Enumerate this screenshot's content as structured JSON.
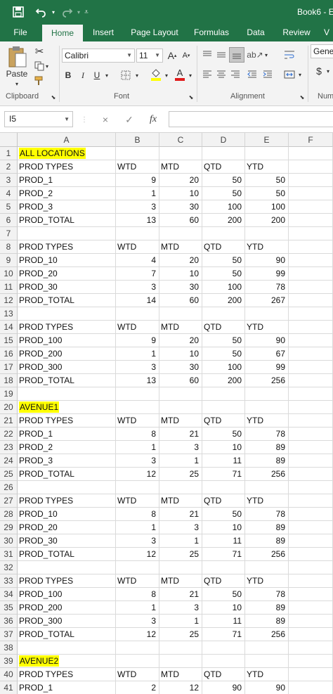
{
  "app": {
    "title": "Book6 - E",
    "accent": "#217346",
    "highlight": "#ffff00"
  },
  "quick_access": {
    "save_icon": "save-icon",
    "undo_icon": "undo-icon",
    "redo_icon": "redo-icon",
    "customize_icon": "customize-qat-icon"
  },
  "tabs": [
    {
      "label": "File",
      "active": false
    },
    {
      "label": "Home",
      "active": true
    },
    {
      "label": "Insert",
      "active": false
    },
    {
      "label": "Page Layout",
      "active": false
    },
    {
      "label": "Formulas",
      "active": false
    },
    {
      "label": "Data",
      "active": false
    },
    {
      "label": "Review",
      "active": false
    },
    {
      "label": "V",
      "active": false
    }
  ],
  "ribbon": {
    "clipboard": {
      "paste_label": "Paste",
      "group_label": "Clipboard"
    },
    "font": {
      "font_name": "Calibri",
      "font_size": "11",
      "bold": "B",
      "italic": "I",
      "underline": "U",
      "grow": "A",
      "shrink": "A",
      "font_color_letter": "A",
      "group_label": "Font"
    },
    "alignment": {
      "group_label": "Alignment"
    },
    "number": {
      "format": "Gene",
      "currency": "$",
      "group_label": "Num"
    }
  },
  "formula_bar": {
    "name_box": "I5",
    "cancel_icon": "×",
    "enter_icon": "✓",
    "fx_label": "fx",
    "value": ""
  },
  "columns": [
    "A",
    "B",
    "C",
    "D",
    "E",
    "F"
  ],
  "rows": [
    [
      "ALL LOCATIONS",
      "",
      "",
      "",
      "",
      ""
    ],
    [
      "PROD TYPES",
      "WTD",
      "MTD",
      "QTD",
      "YTD",
      ""
    ],
    [
      "PROD_1",
      "9",
      "20",
      "50",
      "50",
      ""
    ],
    [
      "PROD_2",
      "1",
      "10",
      "50",
      "50",
      ""
    ],
    [
      "PROD_3",
      "3",
      "30",
      "100",
      "100",
      ""
    ],
    [
      "PROD_TOTAL",
      "13",
      "60",
      "200",
      "200",
      ""
    ],
    [
      "",
      "",
      "",
      "",
      "",
      ""
    ],
    [
      "PROD TYPES",
      "WTD",
      "MTD",
      "QTD",
      "YTD",
      ""
    ],
    [
      "PROD_10",
      "4",
      "20",
      "50",
      "90",
      ""
    ],
    [
      "PROD_20",
      "7",
      "10",
      "50",
      "99",
      ""
    ],
    [
      "PROD_30",
      "3",
      "30",
      "100",
      "78",
      ""
    ],
    [
      "PROD_TOTAL",
      "14",
      "60",
      "200",
      "267",
      ""
    ],
    [
      "",
      "",
      "",
      "",
      "",
      ""
    ],
    [
      "PROD TYPES",
      "WTD",
      "MTD",
      "QTD",
      "YTD",
      ""
    ],
    [
      "PROD_100",
      "9",
      "20",
      "50",
      "90",
      ""
    ],
    [
      "PROD_200",
      "1",
      "10",
      "50",
      "67",
      ""
    ],
    [
      "PROD_300",
      "3",
      "30",
      "100",
      "99",
      ""
    ],
    [
      "PROD_TOTAL",
      "13",
      "60",
      "200",
      "256",
      ""
    ],
    [
      "",
      "",
      "",
      "",
      "",
      ""
    ],
    [
      "AVENUE1",
      "",
      "",
      "",
      "",
      ""
    ],
    [
      "PROD TYPES",
      "WTD",
      "MTD",
      "QTD",
      "YTD",
      ""
    ],
    [
      "PROD_1",
      "8",
      "21",
      "50",
      "78",
      ""
    ],
    [
      "PROD_2",
      "1",
      "3",
      "10",
      "89",
      ""
    ],
    [
      "PROD_3",
      "3",
      "1",
      "11",
      "89",
      ""
    ],
    [
      "PROD_TOTAL",
      "12",
      "25",
      "71",
      "256",
      ""
    ],
    [
      "",
      "",
      "",
      "",
      "",
      ""
    ],
    [
      "PROD TYPES",
      "WTD",
      "MTD",
      "QTD",
      "YTD",
      ""
    ],
    [
      "PROD_10",
      "8",
      "21",
      "50",
      "78",
      ""
    ],
    [
      "PROD_20",
      "1",
      "3",
      "10",
      "89",
      ""
    ],
    [
      "PROD_30",
      "3",
      "1",
      "11",
      "89",
      ""
    ],
    [
      "PROD_TOTAL",
      "12",
      "25",
      "71",
      "256",
      ""
    ],
    [
      "",
      "",
      "",
      "",
      "",
      ""
    ],
    [
      "PROD TYPES",
      "WTD",
      "MTD",
      "QTD",
      "YTD",
      ""
    ],
    [
      "PROD_100",
      "8",
      "21",
      "50",
      "78",
      ""
    ],
    [
      "PROD_200",
      "1",
      "3",
      "10",
      "89",
      ""
    ],
    [
      "PROD_300",
      "3",
      "1",
      "11",
      "89",
      ""
    ],
    [
      "PROD_TOTAL",
      "12",
      "25",
      "71",
      "256",
      ""
    ],
    [
      "",
      "",
      "",
      "",
      "",
      ""
    ],
    [
      "AVENUE2",
      "",
      "",
      "",
      "",
      ""
    ],
    [
      "PROD TYPES",
      "WTD",
      "MTD",
      "QTD",
      "YTD",
      ""
    ],
    [
      "PROD_1",
      "2",
      "12",
      "90",
      "90",
      ""
    ]
  ],
  "highlighted_cells": [
    "A1",
    "A20",
    "A39"
  ],
  "selected_cell": "I5"
}
